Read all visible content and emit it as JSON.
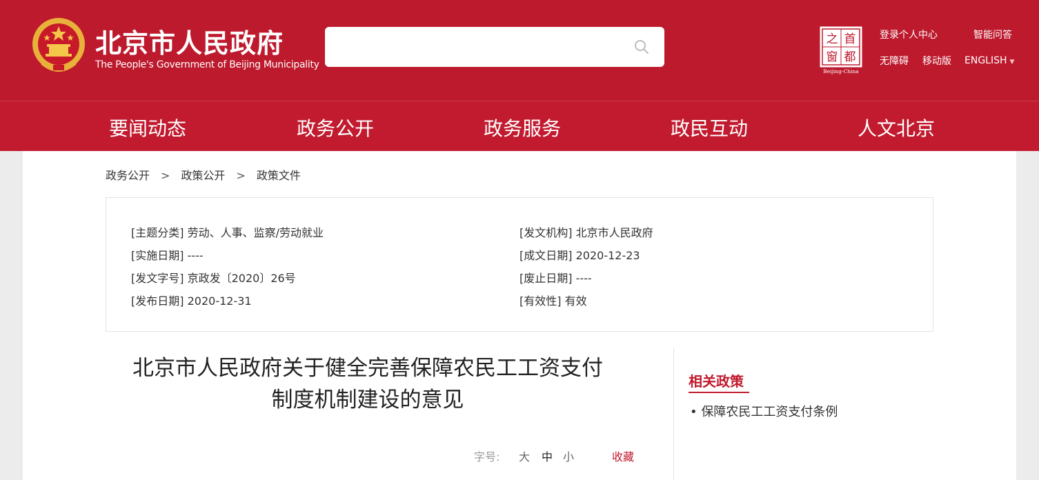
{
  "header": {
    "title": "北京市人民政府",
    "subtitle": "The People's Government of Beijing Municipality",
    "search": {
      "placeholder": ""
    },
    "badge": {
      "chars": [
        "首",
        "都",
        "之",
        "窗"
      ],
      "caption": "Beijing-China"
    },
    "links": {
      "login": "登录个人中心",
      "smart_qa": "智能问答",
      "accessible": "无障碍",
      "mobile": "移动版",
      "english": "ENGLISH",
      "caret": "▼"
    }
  },
  "nav": {
    "items": [
      "要闻动态",
      "政务公开",
      "政务服务",
      "政民互动",
      "人文北京"
    ]
  },
  "breadcrumb": {
    "items": [
      "政务公开",
      "政策公开",
      "政策文件"
    ],
    "separator": ">"
  },
  "meta": {
    "left": [
      {
        "label": "[主题分类]",
        "value": "劳动、人事、监察/劳动就业"
      },
      {
        "label": "[实施日期]",
        "value": "----"
      },
      {
        "label": "[发文字号]",
        "value": "京政发〔2020〕26号"
      },
      {
        "label": "[发布日期]",
        "value": "2020-12-31"
      }
    ],
    "right": [
      {
        "label": "[发文机构]",
        "value": "北京市人民政府"
      },
      {
        "label": "[成文日期]",
        "value": "2020-12-23"
      },
      {
        "label": "[废止日期]",
        "value": "----"
      },
      {
        "label": "[有效性]",
        "value": "有效"
      }
    ]
  },
  "article": {
    "title_line1": "北京市人民政府关于健全完善保障农民工工资支付",
    "title_line2": "制度机制建设的意见"
  },
  "tools": {
    "font_size_label": "字号:",
    "large": "大",
    "medium": "中",
    "small": "小",
    "favorite": "收藏"
  },
  "related": {
    "heading": "相关政策",
    "items": [
      "保障农民工工资支付条例"
    ]
  },
  "colors": {
    "brand_red": "#bd1a2d",
    "nav_red": "#c21b2f",
    "accent_red": "#c0192d",
    "background": "#ececec"
  }
}
